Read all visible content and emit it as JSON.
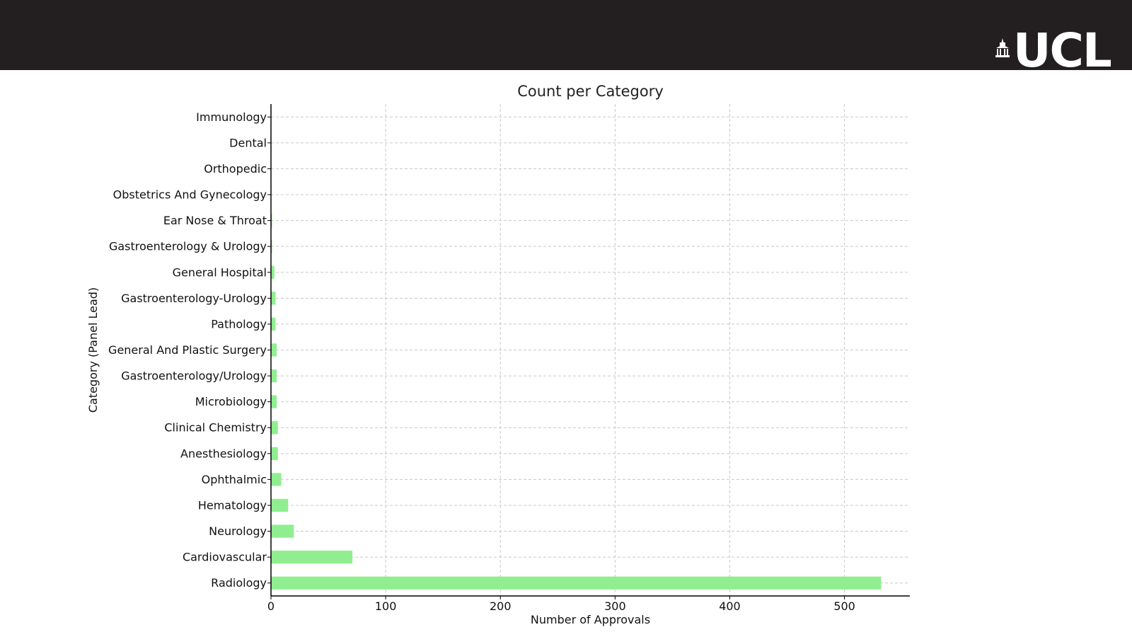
{
  "header": {
    "logo_text": "UCL",
    "background_color": "#231f20",
    "logo_color": "#ffffff"
  },
  "chart_data": {
    "type": "bar",
    "orientation": "horizontal",
    "title": "Count per Category",
    "xlabel": "Number of Approvals",
    "ylabel": "Category (Panel Lead)",
    "categories": [
      "Immunology",
      "Dental",
      "Orthopedic",
      "Obstetrics And Gynecology",
      "Ear Nose & Throat",
      "Gastroenterology & Urology",
      "General Hospital",
      "Gastroenterology-Urology",
      "Pathology",
      "General And Plastic Surgery",
      "Gastroenterology/Urology",
      "Microbiology",
      "Clinical Chemistry",
      "Anesthesiology",
      "Ophthalmic",
      "Hematology",
      "Neurology",
      "Cardiovascular",
      "Radiology"
    ],
    "values": [
      0,
      0,
      0,
      0,
      1,
      1,
      3,
      4,
      4,
      5,
      5,
      5,
      6,
      6,
      9,
      15,
      20,
      71,
      532
    ],
    "xlim": [
      0,
      557
    ],
    "xticks": [
      0,
      100,
      200,
      300,
      400,
      500
    ],
    "grid": true,
    "bar_color": "#90ee90"
  }
}
